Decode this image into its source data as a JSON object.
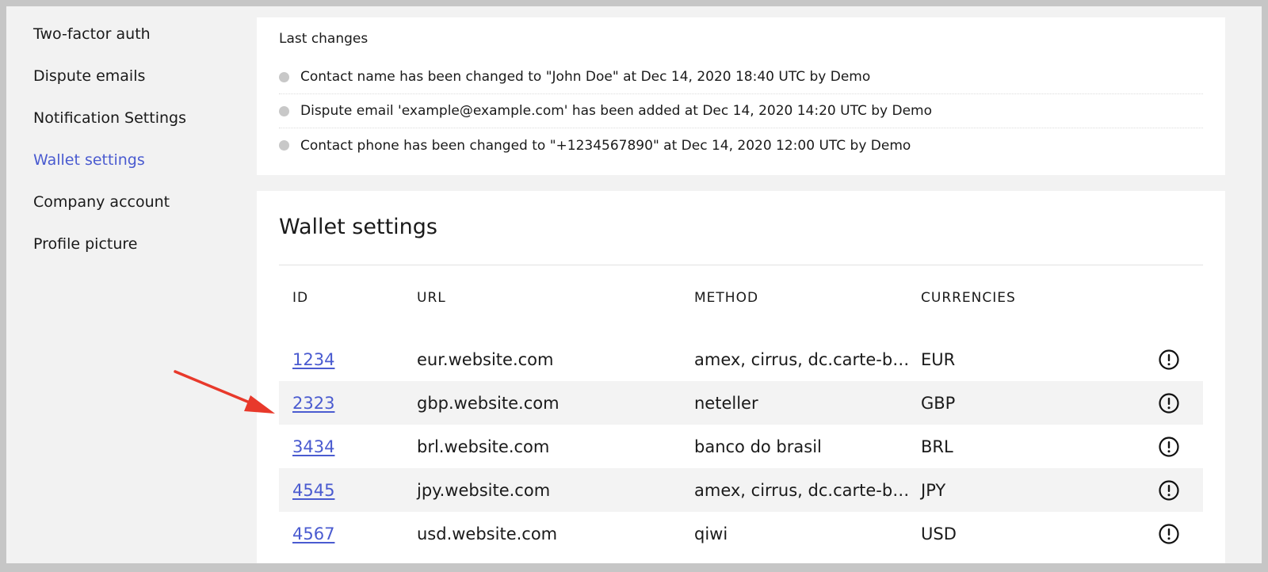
{
  "sidebar": {
    "items": [
      {
        "label": "Two-factor auth",
        "active": false
      },
      {
        "label": "Dispute emails",
        "active": false
      },
      {
        "label": "Notification Settings",
        "active": false
      },
      {
        "label": "Wallet settings",
        "active": true
      },
      {
        "label": "Company account",
        "active": false
      },
      {
        "label": "Profile picture",
        "active": false
      }
    ]
  },
  "changes": {
    "title": "Last changes",
    "items": [
      "Contact name has been changed to \"John Doe\" at Dec 14, 2020 18:40 UTC by Demo",
      "Dispute email 'example@example.com' has been added at Dec 14, 2020 14:20 UTC by Demo",
      "Contact phone has been changed to \"+1234567890\" at Dec 14, 2020 12:00 UTC by Demo"
    ]
  },
  "wallet": {
    "title": "Wallet settings",
    "columns": {
      "id": "ID",
      "url": "URL",
      "method": "METHOD",
      "currencies": "CURRENCIES"
    },
    "rows": [
      {
        "id": "1234",
        "url": "eur.website.com",
        "method": "amex, cirrus, dc.carte-bl…",
        "currency": "EUR"
      },
      {
        "id": "2323",
        "url": "gbp.website.com",
        "method": "neteller",
        "currency": "GBP"
      },
      {
        "id": "3434",
        "url": "brl.website.com",
        "method": "banco do brasil",
        "currency": "BRL"
      },
      {
        "id": "4545",
        "url": "jpy.website.com",
        "method": "amex, cirrus, dc.carte-bl…",
        "currency": "JPY"
      },
      {
        "id": "4567",
        "url": "usd.website.com",
        "method": "qiwi",
        "currency": "USD"
      }
    ],
    "row_icon": "exclamation-circle-icon"
  },
  "annotation": {
    "type": "red-arrow",
    "color": "#e8392b",
    "points_to": "2323"
  },
  "colors": {
    "accent": "#4a5bd0",
    "page_bg": "#f2f2f2",
    "frame": "#c6c6c6",
    "alt_row": "#f3f3f3"
  }
}
